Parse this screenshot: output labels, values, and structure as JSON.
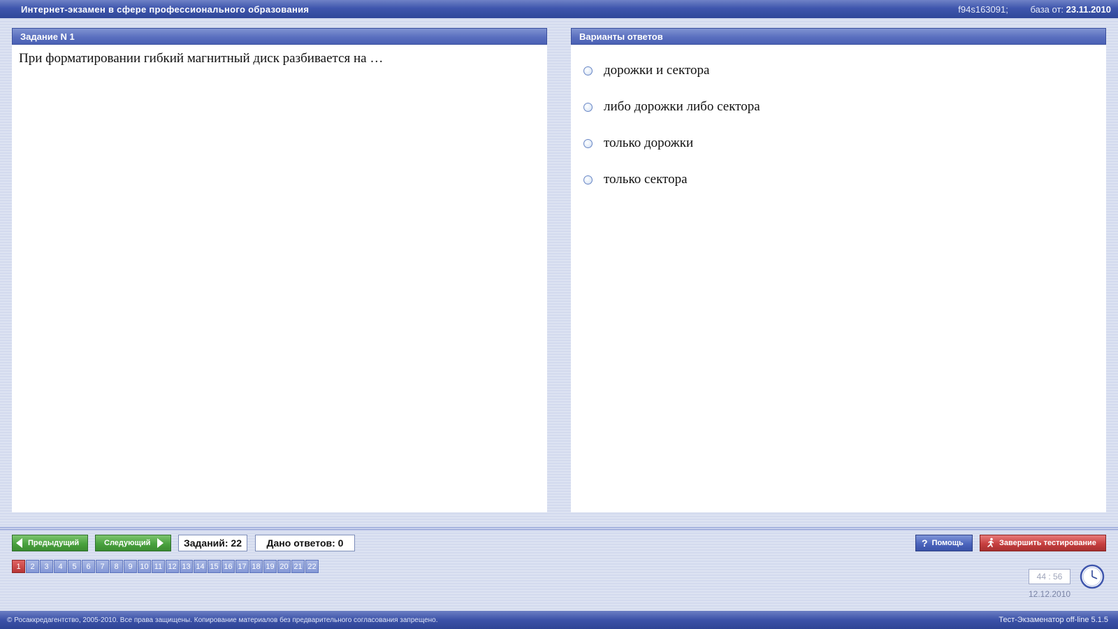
{
  "header": {
    "title": "Интернет-экзамен в сфере профессионального образования",
    "code": "f94s163091;",
    "base_label": "база от:",
    "base_date": "23.11.2010"
  },
  "task_panel": {
    "title": "Задание N 1",
    "question": "При форматировании гибкий магнитный диск разбивается на …"
  },
  "answers_panel": {
    "title": "Варианты ответов",
    "options": [
      {
        "label": "дорожки и сектора"
      },
      {
        "label": "либо дорожки либо сектора"
      },
      {
        "label": "только дорожки"
      },
      {
        "label": "только сектора"
      }
    ]
  },
  "nav": {
    "prev_label": "Предыдущий",
    "next_label": "Следующий",
    "tasks_count": "Заданий: 22",
    "answers_given": "Дано ответов: 0",
    "help_label": "Помощь",
    "finish_label": "Завершить тестирование"
  },
  "task_numbers": [
    "1",
    "2",
    "3",
    "4",
    "5",
    "6",
    "7",
    "8",
    "9",
    "10",
    "11",
    "12",
    "13",
    "14",
    "15",
    "16",
    "17",
    "18",
    "19",
    "20",
    "21",
    "22"
  ],
  "current_task": "1",
  "timer": {
    "time": "44 : 56",
    "date": "12.12.2010"
  },
  "footer": {
    "copyright": "© Росаккредагентство, 2005-2010. Все права защищены. Копирование материалов без предварительного согласования запрещено.",
    "version": "Тест-Экзаменатор off-line 5.1.5"
  },
  "colors": {
    "accent_blue": "#3f56ad",
    "green_button": "#4aa23f",
    "red_button": "#c74040",
    "current_task": "#b83535"
  },
  "icons": {
    "prev": "arrow-left-icon",
    "next": "arrow-right-icon",
    "help": "question-icon",
    "finish": "running-man-icon",
    "timer": "clock-icon",
    "option": "radio-icon"
  }
}
